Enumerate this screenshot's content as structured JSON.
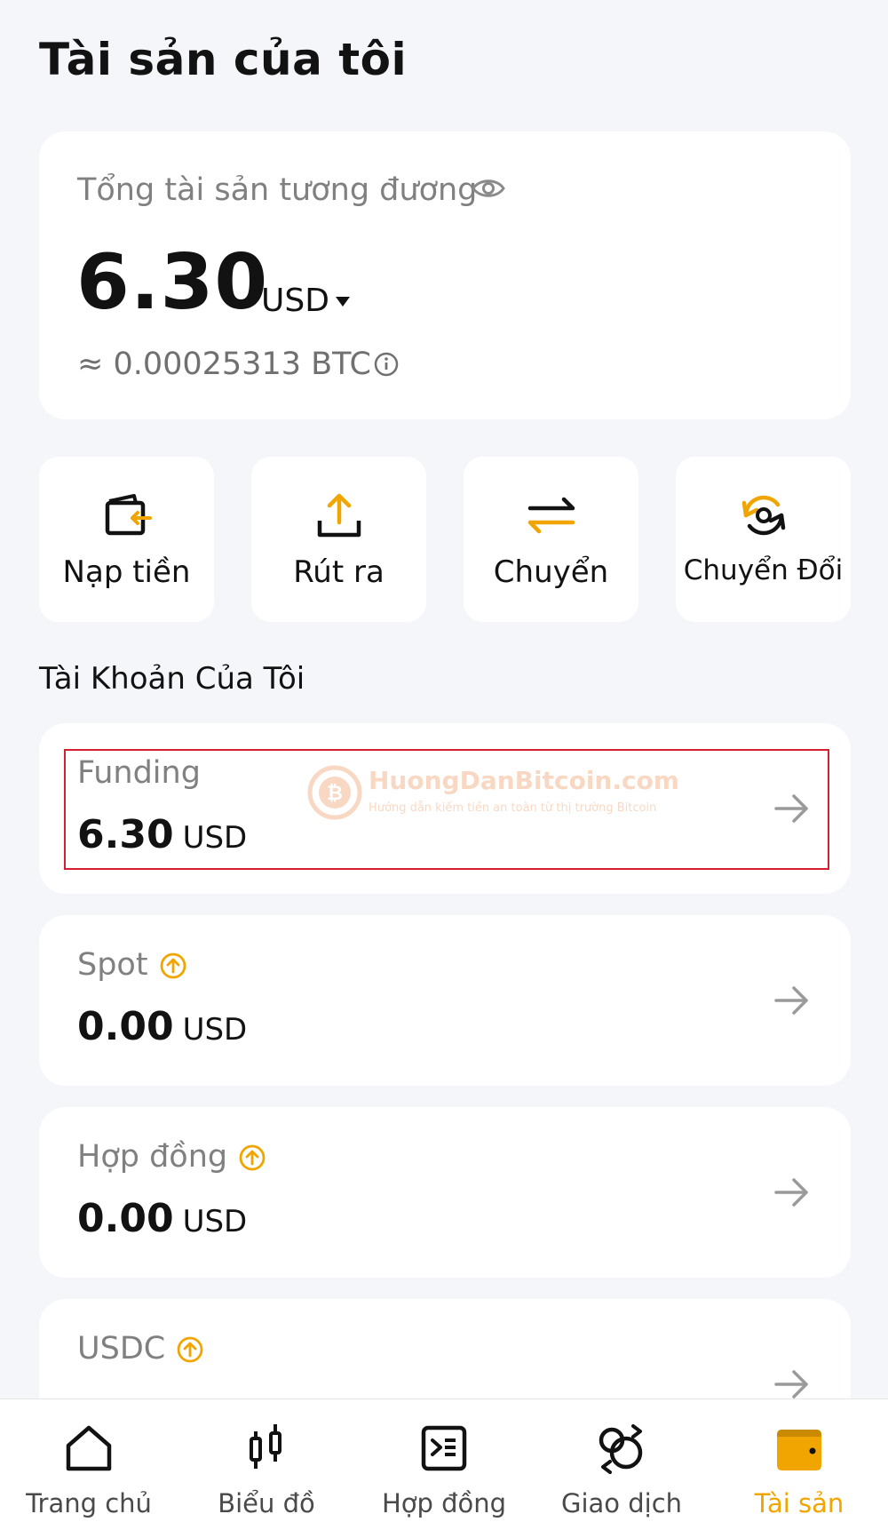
{
  "header": {
    "title": "Tài sản của tôi"
  },
  "total": {
    "label": "Tổng tài sản tương đương",
    "value": "6.30",
    "currency": "USD",
    "btc_equivalent": "≈ 0.00025313 BTC"
  },
  "actions": [
    {
      "label": "Nạp tiền",
      "icon": "deposit-icon"
    },
    {
      "label": "Rút ra",
      "icon": "withdraw-icon"
    },
    {
      "label": "Chuyển",
      "icon": "transfer-icon"
    },
    {
      "label": "Chuyển Đổi",
      "icon": "convert-icon"
    }
  ],
  "accounts_section": {
    "title": "Tài Khoản Của Tôi"
  },
  "accounts": [
    {
      "name": "Funding",
      "value": "6.30",
      "unit": "USD",
      "upgrade": false
    },
    {
      "name": "Spot",
      "value": "0.00",
      "unit": "USD",
      "upgrade": true
    },
    {
      "name": "Hợp đồng",
      "value": "0.00",
      "unit": "USD",
      "upgrade": true
    },
    {
      "name": "USDC",
      "value": "",
      "unit": "",
      "upgrade": true
    }
  ],
  "watermark": {
    "title": "HuongDanBitcoin.com",
    "subtitle": "Hướng dẫn kiếm tiền an toàn từ thị trường Bitcoin"
  },
  "tabbar": {
    "items": [
      {
        "label": "Trang chủ",
        "icon": "home-icon"
      },
      {
        "label": "Biểu đồ",
        "icon": "candlestick-icon"
      },
      {
        "label": "Hợp đồng",
        "icon": "contract-icon"
      },
      {
        "label": "Giao dịch",
        "icon": "trade-icon"
      },
      {
        "label": "Tài sản",
        "icon": "wallet-icon"
      }
    ],
    "active_index": 4
  },
  "colors": {
    "accent": "#f0a500",
    "highlight": "#d32030",
    "background": "#f5f6fa"
  }
}
